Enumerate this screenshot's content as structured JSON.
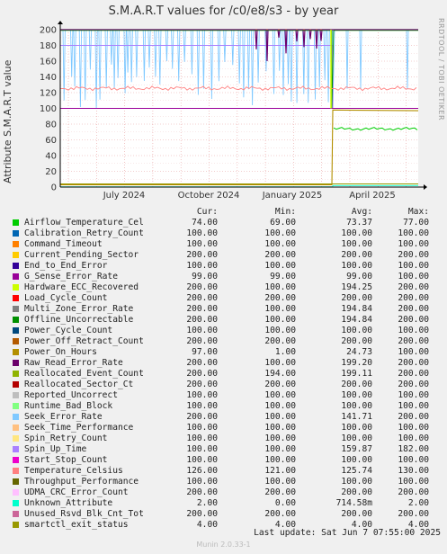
{
  "title": "S.M.A.R.T values for /c0/e8/s3 - by year",
  "side_label": "RRDTOOL / TOBI OETIKER",
  "footer": "Munin 2.0.33-1",
  "last_update": "Last update:  Sat Jun  7 07:55:00 2025",
  "legend_headers": {
    "cur": "Cur:",
    "min": "Min:",
    "avg": "Avg:",
    "max": "Max:"
  },
  "chart_data": {
    "type": "line",
    "title": "S.M.A.R.T values for /c0/e8/s3 - by year",
    "ylabel": "Attribute S.M.A.R.T value",
    "ylim": [
      0,
      200
    ],
    "yticks": [
      "0",
      "20",
      "40",
      "60",
      "80",
      "100",
      "120",
      "140",
      "160",
      "180",
      "200"
    ],
    "xtick_labels": [
      "July 2024",
      "October 2024",
      "January 2025",
      "April 2025"
    ],
    "grid": true,
    "series": [
      {
        "name": "Airflow_Temperature_Cel",
        "color": "#00cc00",
        "cur": "74.00",
        "min": "69.00",
        "avg": "73.37",
        "max": "77.00"
      },
      {
        "name": "Calibration_Retry_Count",
        "color": "#0066b3",
        "cur": "100.00",
        "min": "100.00",
        "avg": "100.00",
        "max": "100.00"
      },
      {
        "name": "Command_Timeout",
        "color": "#ff8000",
        "cur": "100.00",
        "min": "100.00",
        "avg": "100.00",
        "max": "100.00"
      },
      {
        "name": "Current_Pending_Sector",
        "color": "#ffcc00",
        "cur": "200.00",
        "min": "200.00",
        "avg": "200.00",
        "max": "200.00"
      },
      {
        "name": "End_to_End_Error",
        "color": "#330099",
        "cur": "100.00",
        "min": "100.00",
        "avg": "100.00",
        "max": "100.00"
      },
      {
        "name": "G_Sense_Error_Rate",
        "color": "#990099",
        "cur": "99.00",
        "min": "99.00",
        "avg": "99.00",
        "max": "100.00"
      },
      {
        "name": "Hardware_ECC_Recovered",
        "color": "#ccff00",
        "cur": "200.00",
        "min": "100.00",
        "avg": "194.25",
        "max": "200.00"
      },
      {
        "name": "Load_Cycle_Count",
        "color": "#ff0000",
        "cur": "200.00",
        "min": "200.00",
        "avg": "200.00",
        "max": "200.00"
      },
      {
        "name": "Multi_Zone_Error_Rate",
        "color": "#808080",
        "cur": "200.00",
        "min": "100.00",
        "avg": "194.84",
        "max": "200.00"
      },
      {
        "name": "Offline_Uncorrectable",
        "color": "#008f00",
        "cur": "200.00",
        "min": "100.00",
        "avg": "194.84",
        "max": "200.00"
      },
      {
        "name": "Power_Cycle_Count",
        "color": "#00487d",
        "cur": "100.00",
        "min": "100.00",
        "avg": "100.00",
        "max": "100.00"
      },
      {
        "name": "Power_Off_Retract_Count",
        "color": "#b35a00",
        "cur": "200.00",
        "min": "200.00",
        "avg": "200.00",
        "max": "200.00"
      },
      {
        "name": "Power_On_Hours",
        "color": "#b38f00",
        "cur": "97.00",
        "min": "1.00",
        "avg": "24.73",
        "max": "100.00"
      },
      {
        "name": "Raw_Read_Error_Rate",
        "color": "#6b006b",
        "cur": "200.00",
        "min": "100.00",
        "avg": "199.20",
        "max": "200.00"
      },
      {
        "name": "Reallocated_Event_Count",
        "color": "#8fb300",
        "cur": "200.00",
        "min": "194.00",
        "avg": "199.11",
        "max": "200.00"
      },
      {
        "name": "Reallocated_Sector_Ct",
        "color": "#b30000",
        "cur": "200.00",
        "min": "200.00",
        "avg": "200.00",
        "max": "200.00"
      },
      {
        "name": "Reported_Uncorrect",
        "color": "#bebebe",
        "cur": "100.00",
        "min": "100.00",
        "avg": "100.00",
        "max": "100.00"
      },
      {
        "name": "Runtime_Bad_Block",
        "color": "#80ff80",
        "cur": "100.00",
        "min": "100.00",
        "avg": "100.00",
        "max": "100.00"
      },
      {
        "name": "Seek_Error_Rate",
        "color": "#80c9ff",
        "cur": "200.00",
        "min": "100.00",
        "avg": "141.71",
        "max": "200.00"
      },
      {
        "name": "Seek_Time_Performance",
        "color": "#ffc080",
        "cur": "100.00",
        "min": "100.00",
        "avg": "100.00",
        "max": "100.00"
      },
      {
        "name": "Spin_Retry_Count",
        "color": "#ffe680",
        "cur": "100.00",
        "min": "100.00",
        "avg": "100.00",
        "max": "100.00"
      },
      {
        "name": "Spin_Up_Time",
        "color": "#aa80ff",
        "cur": "100.00",
        "min": "100.00",
        "avg": "159.87",
        "max": "182.00"
      },
      {
        "name": "Start_Stop_Count",
        "color": "#ee00cc",
        "cur": "100.00",
        "min": "100.00",
        "avg": "100.00",
        "max": "100.00"
      },
      {
        "name": "Temperature_Celsius",
        "color": "#ff8080",
        "cur": "126.00",
        "min": "121.00",
        "avg": "125.74",
        "max": "130.00"
      },
      {
        "name": "Throughput_Performance",
        "color": "#666600",
        "cur": "100.00",
        "min": "100.00",
        "avg": "100.00",
        "max": "100.00"
      },
      {
        "name": "UDMA_CRC_Error_Count",
        "color": "#ffbfff",
        "cur": "200.00",
        "min": "200.00",
        "avg": "200.00",
        "max": "200.00"
      },
      {
        "name": "Unknown_Attribute",
        "color": "#00ffcc",
        "cur": "2.00",
        "min": "0.00",
        "avg": "714.58m",
        "max": "2.00"
      },
      {
        "name": "Unused_Rsvd_Blk_Cnt_Tot",
        "color": "#cc6699",
        "cur": "200.00",
        "min": "200.00",
        "avg": "200.00",
        "max": "200.00"
      },
      {
        "name": "smartctl_exit_status",
        "color": "#999900",
        "cur": "4.00",
        "min": "4.00",
        "avg": "4.00",
        "max": "4.00"
      }
    ]
  }
}
